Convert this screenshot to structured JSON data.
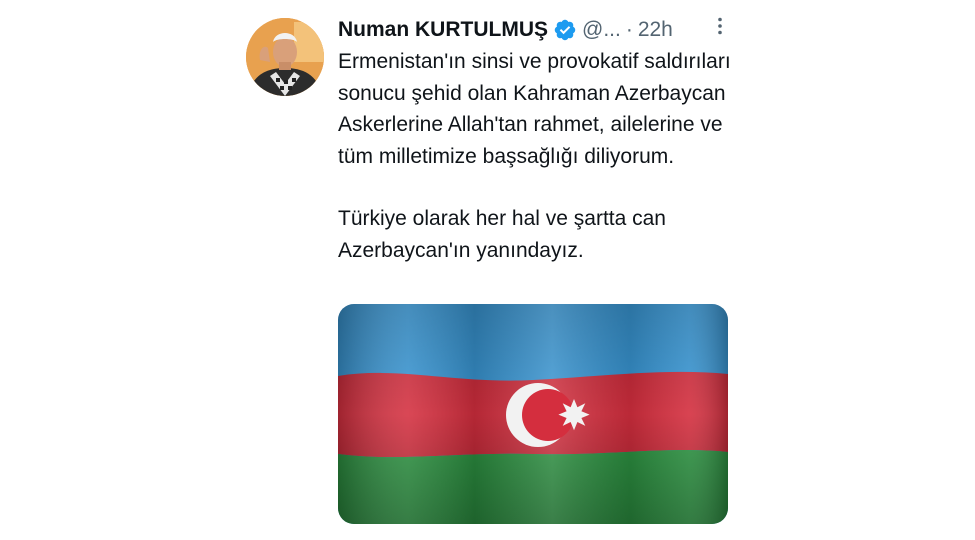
{
  "tweet": {
    "author": {
      "display_name": "Numan KURTULMUŞ",
      "handle": "@...",
      "verified": true,
      "avatar_icon": "profile-photo"
    },
    "separator": "·",
    "timestamp": "22h",
    "more_icon": "more-vertical-icon",
    "text": {
      "paragraph_1": "Ermenistan'ın sinsi ve provokatif saldırıları sonucu şehid olan Kahraman Azerbaycan Askerlerine Allah'tan rahmet, ailelerine ve tüm milletimize başsağlığı diliyorum.",
      "paragraph_2": "Türkiye olarak her hal ve şartta can Azerbaycan'ın yanındayız."
    },
    "media": {
      "kind": "image",
      "subject": "flag-of-azerbaijan",
      "colors": {
        "stripe_top": "#3a9ad9",
        "stripe_middle": "#d42e3e",
        "stripe_bottom": "#2f9a45",
        "emblem": "#ffffff"
      }
    },
    "colors": {
      "text_primary": "#0f1419",
      "text_secondary": "#536471",
      "verified_badge": "#1d9bf0"
    }
  }
}
